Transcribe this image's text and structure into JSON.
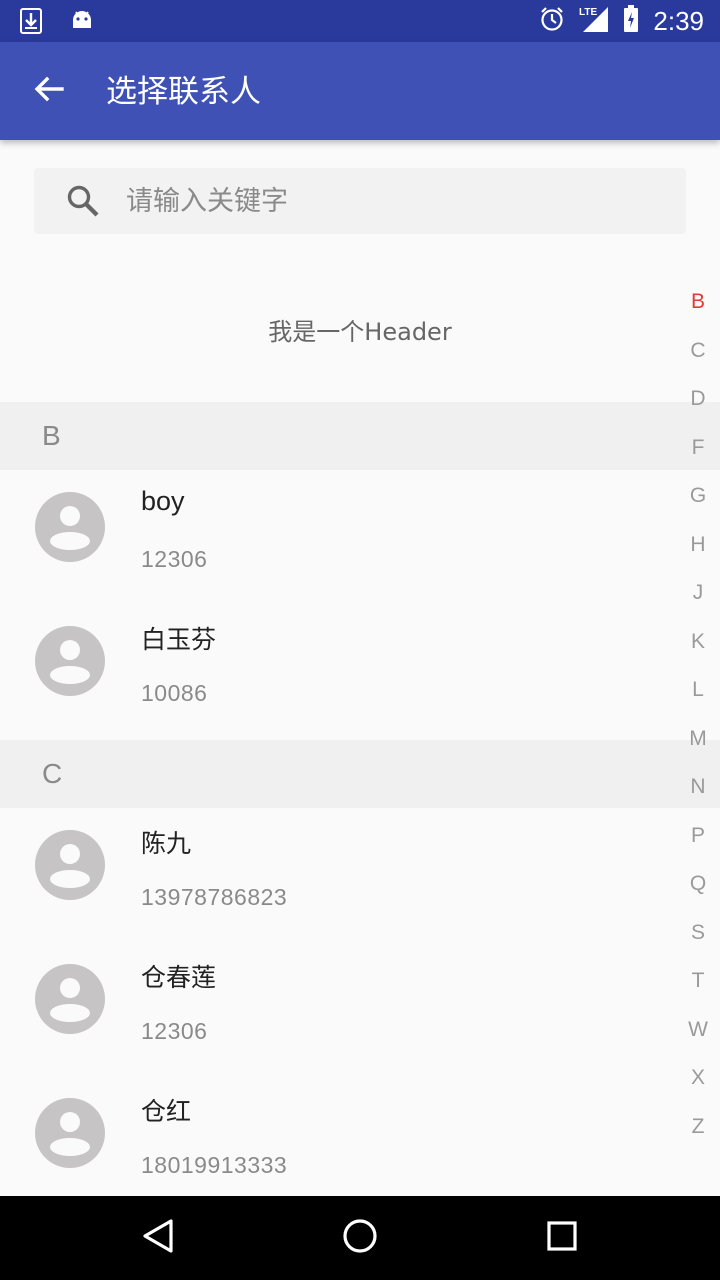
{
  "status_bar": {
    "time": "2:39",
    "icons": [
      "download-icon",
      "android-icon",
      "alarm-icon",
      "lte-signal-icon",
      "battery-icon"
    ],
    "network_label": "LTE"
  },
  "app_bar": {
    "title": "选择联系人",
    "back_icon": "arrow-back-icon",
    "color": "#3f51b5"
  },
  "search": {
    "placeholder": "请输入关键字",
    "value": ""
  },
  "header": {
    "text": "我是一个Header"
  },
  "sections": [
    {
      "letter": "B",
      "contacts": [
        {
          "name": "boy",
          "phone": "12306"
        },
        {
          "name": "白玉芬",
          "phone": "10086"
        }
      ]
    },
    {
      "letter": "C",
      "contacts": [
        {
          "name": "陈九",
          "phone": "13978786823"
        },
        {
          "name": "仓春莲",
          "phone": "12306"
        },
        {
          "name": "仓红",
          "phone": "18019913333"
        }
      ]
    }
  ],
  "index_bar": {
    "letters": [
      "B",
      "C",
      "D",
      "F",
      "G",
      "H",
      "J",
      "K",
      "L",
      "M",
      "N",
      "P",
      "Q",
      "S",
      "T",
      "W",
      "X",
      "Z"
    ],
    "active": "B",
    "active_color": "#e53935"
  },
  "nav_bar": {
    "buttons": [
      "back-triangle-icon",
      "home-circle-icon",
      "recents-square-icon"
    ]
  }
}
